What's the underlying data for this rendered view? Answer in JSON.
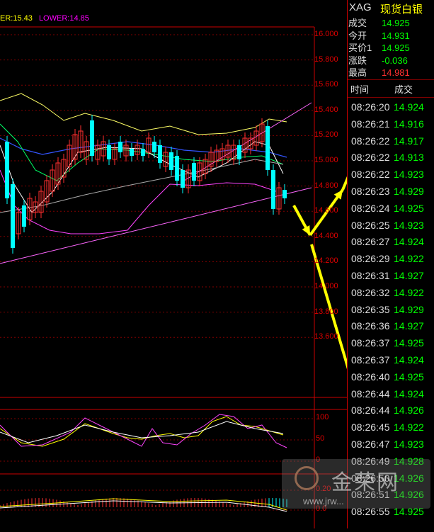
{
  "symbol": {
    "code": "XAG",
    "name": "现货白银"
  },
  "legend": {
    "upper": "ER:15.43",
    "lower": "LOWER:14.85"
  },
  "quote": [
    {
      "label": "成交",
      "value": "14.925",
      "color": "#00ff00"
    },
    {
      "label": "今开",
      "value": "14.931",
      "color": "#00ff00"
    },
    {
      "label": "买价1",
      "value": "14.925",
      "color": "#00ff00"
    },
    {
      "label": "涨跌",
      "value": "-0.036",
      "color": "#00ff00"
    },
    {
      "label": "最高",
      "value": "14.981",
      "color": "#ff3030"
    }
  ],
  "ticks_header": {
    "time": "时间",
    "price": "成交"
  },
  "ticks": [
    {
      "time": "08:26:20",
      "price": "14.924",
      "color": "#00ff00"
    },
    {
      "time": "08:26:21",
      "price": "14.916",
      "color": "#00ff00"
    },
    {
      "time": "08:26:22",
      "price": "14.917",
      "color": "#00ff00"
    },
    {
      "time": "08:26:22",
      "price": "14.913",
      "color": "#00ff00"
    },
    {
      "time": "08:26:22",
      "price": "14.923",
      "color": "#00ff00"
    },
    {
      "time": "08:26:23",
      "price": "14.929",
      "color": "#00ff00"
    },
    {
      "time": "08:26:24",
      "price": "14.925",
      "color": "#00ff00"
    },
    {
      "time": "08:26:25",
      "price": "14.923",
      "color": "#00ff00"
    },
    {
      "time": "08:26:27",
      "price": "14.924",
      "color": "#00ff00"
    },
    {
      "time": "08:26:29",
      "price": "14.922",
      "color": "#00ff00"
    },
    {
      "time": "08:26:31",
      "price": "14.927",
      "color": "#00ff00"
    },
    {
      "time": "08:26:32",
      "price": "14.922",
      "color": "#00ff00"
    },
    {
      "time": "08:26:35",
      "price": "14.929",
      "color": "#00ff00"
    },
    {
      "time": "08:26:36",
      "price": "14.927",
      "color": "#00ff00"
    },
    {
      "time": "08:26:37",
      "price": "14.925",
      "color": "#00ff00"
    },
    {
      "time": "08:26:37",
      "price": "14.924",
      "color": "#00ff00"
    },
    {
      "time": "08:26:40",
      "price": "14.925",
      "color": "#00ff00"
    },
    {
      "time": "08:26:44",
      "price": "14.924",
      "color": "#00ff00"
    },
    {
      "time": "08:26:44",
      "price": "14.926",
      "color": "#00ff00"
    },
    {
      "time": "08:26:45",
      "price": "14.922",
      "color": "#00ff00"
    },
    {
      "time": "08:26:47",
      "price": "14.923",
      "color": "#00ff00"
    },
    {
      "time": "08:26:49",
      "price": "14.928",
      "color": "#00ff00"
    },
    {
      "time": "08:26:50",
      "price": "14.926",
      "color": "#00ff00"
    },
    {
      "time": "08:26:51",
      "price": "14.926",
      "color": "#00ff00"
    },
    {
      "time": "08:26:55",
      "price": "14.925",
      "color": "#00ff00"
    }
  ],
  "y_axis": [
    "16.000",
    "15.800",
    "15.600",
    "15.400",
    "15.200",
    "15.000",
    "14.800",
    "14.600",
    "14.400",
    "14.200",
    "14.000",
    "13.800",
    "13.600"
  ],
  "osc_axis": [
    "100",
    "50",
    "0"
  ],
  "macd_axis": [
    "0.20",
    "0.0"
  ],
  "watermark": {
    "name": "金荣网",
    "url": "www.jrw..."
  },
  "colors": {
    "up": "#ff3030",
    "down": "#00ffff",
    "grid": "#800000",
    "axis": "#cc0000"
  }
}
